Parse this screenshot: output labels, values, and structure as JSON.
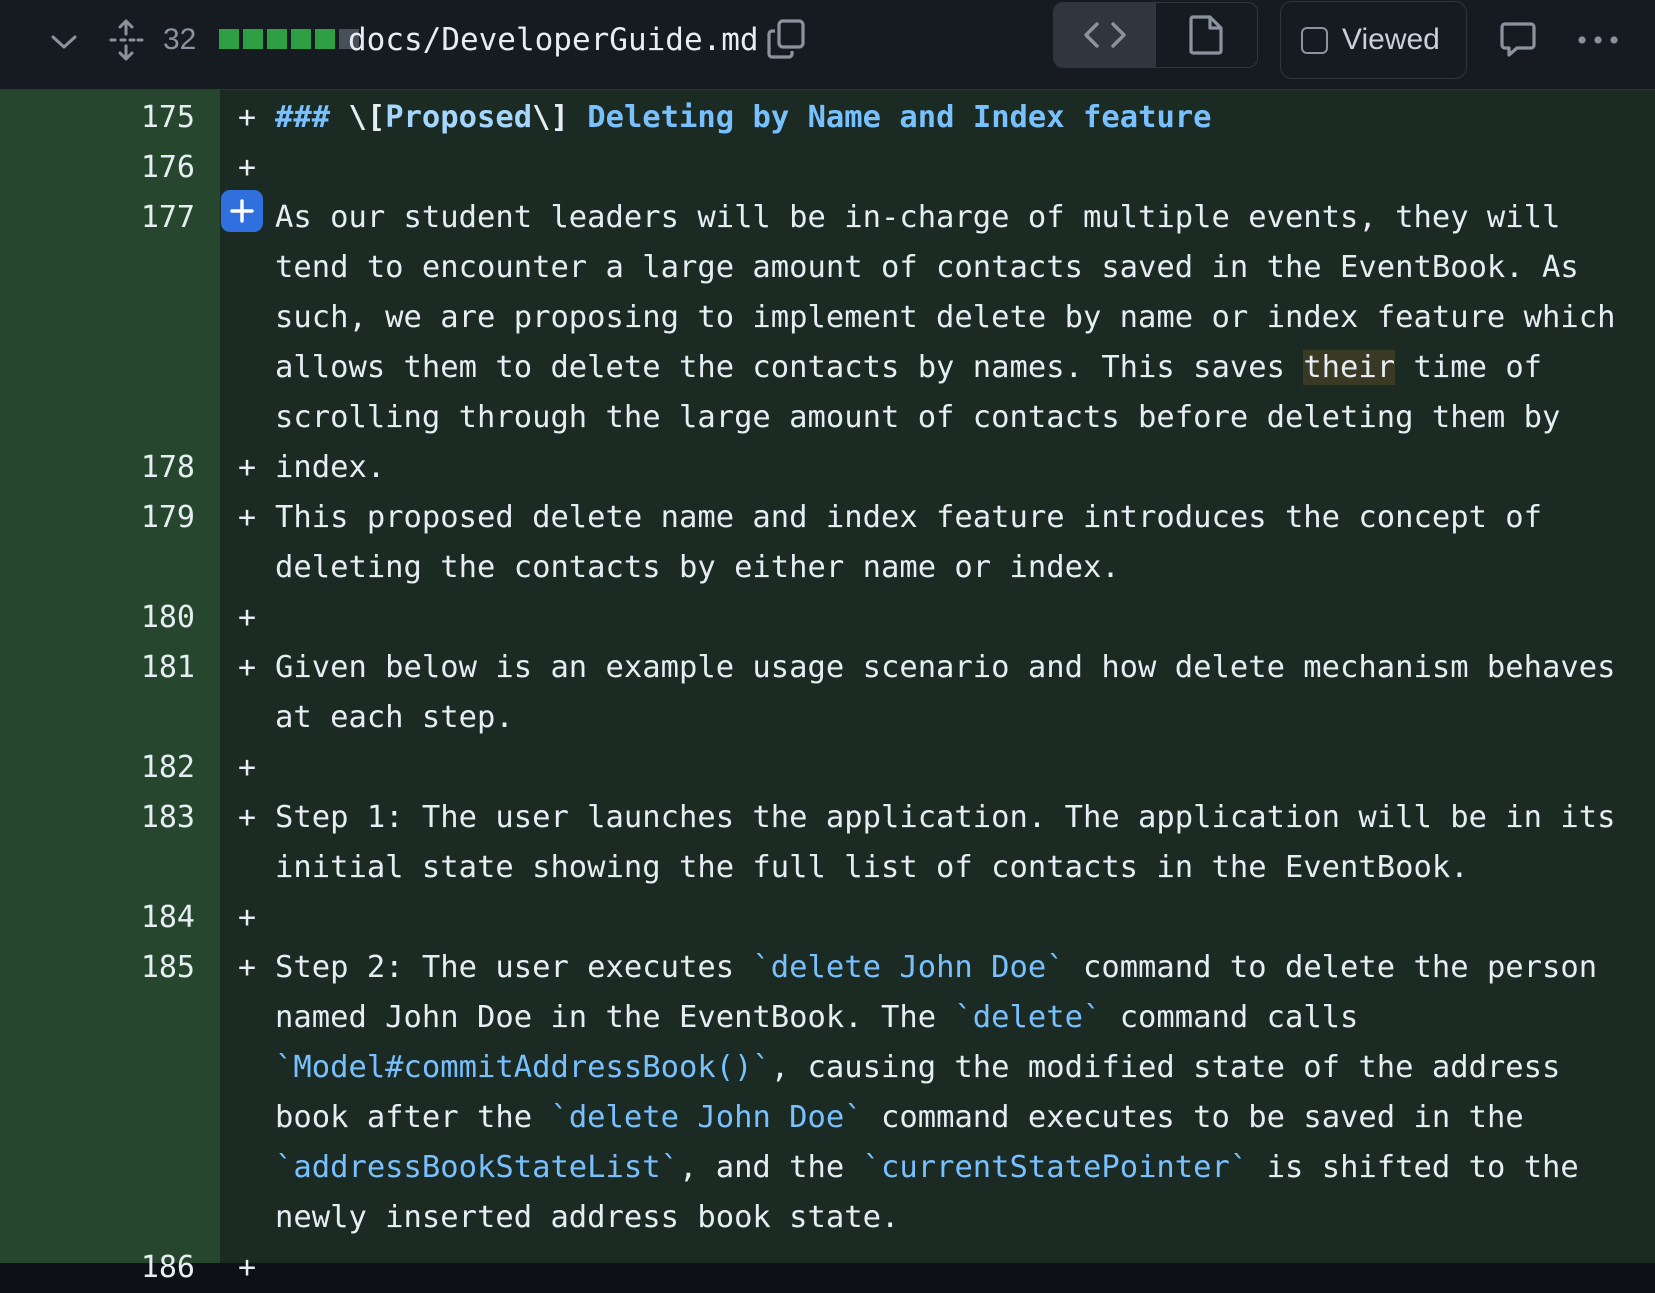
{
  "header": {
    "collapse_icon": "chevron-down-icon",
    "expand_icon": "unfold-icon",
    "changed_lines": "32",
    "diffstat_colors": [
      "#2ea043",
      "#2ea043",
      "#2ea043",
      "#2ea043",
      "#2ea043",
      "#484f58"
    ],
    "filename": "docs/DeveloperGuide.md",
    "copy_icon": "copy-icon",
    "code_view_icon": "code-icon",
    "file_view_icon": "file-icon",
    "viewed_label": "Viewed",
    "comment_icon": "comment-icon",
    "more_icon": "kebab-horizontal-icon"
  },
  "colors": {
    "addition_bg": "#1b2b23",
    "addition_gutter": "#26472e",
    "accent_blue": "#2f6fde",
    "code_blue": "#79c0ff"
  },
  "lines": [
    {
      "no": "175",
      "marker": "+"
    },
    {
      "no": "176",
      "marker": "+"
    },
    {
      "no": "177",
      "marker": "+"
    },
    {
      "no": "178",
      "marker": "+"
    },
    {
      "no": "179",
      "marker": "+"
    },
    {
      "no": "180",
      "marker": "+"
    },
    {
      "no": "181",
      "marker": "+"
    },
    {
      "no": "182",
      "marker": "+"
    },
    {
      "no": "183",
      "marker": "+"
    },
    {
      "no": "184",
      "marker": "+"
    },
    {
      "no": "185",
      "marker": "+"
    },
    {
      "no": "186",
      "marker": "+"
    }
  ],
  "text": {
    "l175_hashes": "###",
    "l175_open": "\\[",
    "l175_word": "Proposed",
    "l175_close": "\\]",
    "l175_rest": "Deleting by Name and Index feature",
    "l177_a": "As our student leaders will be in-charge of multiple events, they will tend to encounter a large amount of contacts saved in the EventBook. As such, we are proposing to implement delete by name or index feature which allows them to delete the contacts by names. This saves ",
    "l177_their": "their",
    "l177_b": " time of scrolling through the large amount of contacts before deleting them by index.",
    "l179": "This proposed delete name and index feature introduces the concept of deleting the contacts by either name or index.",
    "l181": "Given below is an example usage scenario and how delete mechanism behaves at each step.",
    "l183": "Step 1: The user launches the application. The application will be in its initial state showing the full list of contacts in the EventBook.",
    "l185_a": "Step 2: The user executes ",
    "l185_c1": "`delete John Doe`",
    "l185_b": " command to delete the person named John Doe in the EventBook. The ",
    "l185_c2": "`delete`",
    "l185_c": " command calls ",
    "l185_c3": "`Model#commitAddressBook()`",
    "l185_d": ", causing the modified state of the address book after the ",
    "l185_c4": "`delete John Doe`",
    "l185_e": " command executes to be saved in the ",
    "l185_c5": "`addressBookStateList`",
    "l185_f": ", and the ",
    "l185_c6": "`currentStatePointer`",
    "l185_g": " is shifted to the newly inserted address book state."
  }
}
